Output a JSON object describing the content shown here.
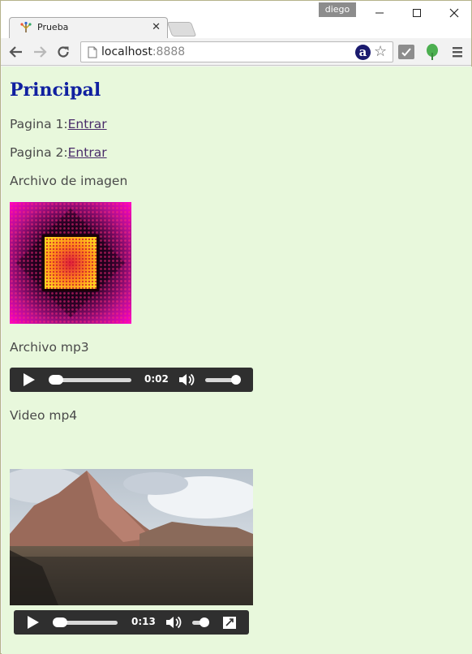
{
  "window": {
    "user": "diego",
    "tab_title": "Prueba",
    "url_host": "localhost",
    "url_port": ":8888",
    "ext_a_label": "a"
  },
  "page": {
    "heading": "Principal",
    "link1_prefix": "Pagina 1:",
    "link1_text": "Entrar",
    "link2_prefix": "Pagina 2:",
    "link2_text": "Entrar",
    "image_label": "Archivo de imagen",
    "audio_label": "Archivo mp3",
    "video_label": "Video mp4"
  },
  "audio_player": {
    "time": "0:02",
    "progress": 0.03,
    "volume": 0.9
  },
  "video_player": {
    "time": "0:13",
    "progress": 0.03,
    "volume": 0.6
  },
  "colors": {
    "page_background": "#e8f8dc",
    "heading": "#1020a0",
    "link": "#4a2c6a",
    "player_bg": "#2f2f2f"
  }
}
